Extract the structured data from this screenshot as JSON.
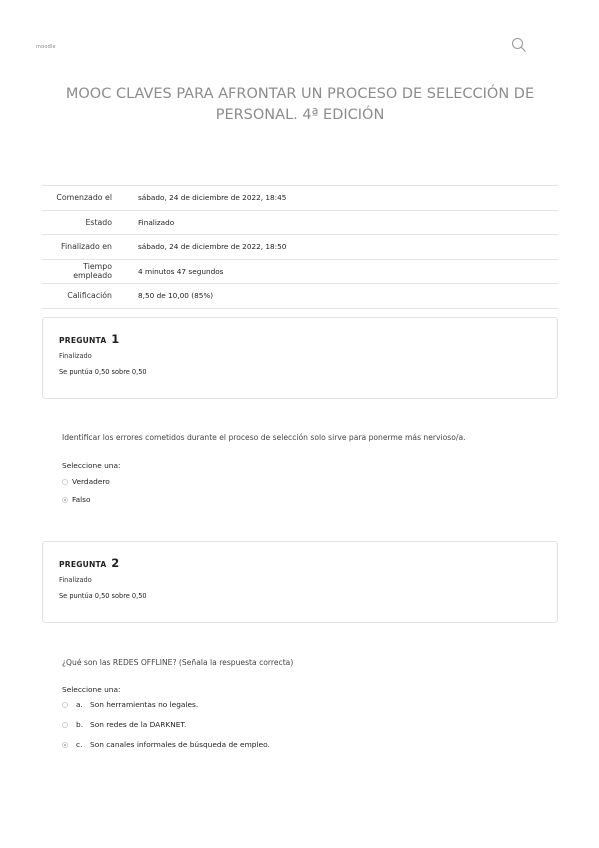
{
  "header": {
    "logo_text": "moodle",
    "search_icon": "search-icon"
  },
  "course": {
    "title": "MOOC CLAVES PARA AFRONTAR UN PROCESO DE SELECCIÓN DE PERSONAL. 4ª EDICIÓN"
  },
  "summary": [
    {
      "key": "Comenzado el",
      "value": "sábado, 24 de diciembre de 2022, 18:45"
    },
    {
      "key": "Estado",
      "value": "Finalizado"
    },
    {
      "key": "Finalizado en",
      "value": "sábado, 24 de diciembre de 2022, 18:50"
    },
    {
      "key": "Tiempo empleado",
      "value": "4 minutos 47 segundos"
    },
    {
      "key": "Calificación",
      "value": "8,50 de 10,00 (85%)"
    }
  ],
  "questions": [
    {
      "label": "PREGUNTA",
      "number": "1",
      "state": "Finalizado",
      "grade": "Se puntúa 0,50 sobre 0,50",
      "text": "Identificar los errores cometidos durante el proceso de selección solo sirve para ponerme más nervioso/a.",
      "select_label": "Seleccione una:",
      "options": [
        {
          "letter": "",
          "text": "Verdadero",
          "checked": false
        },
        {
          "letter": "",
          "text": "Falso",
          "checked": true
        }
      ]
    },
    {
      "label": "PREGUNTA",
      "number": "2",
      "state": "Finalizado",
      "grade": "Se puntúa 0,50 sobre 0,50",
      "text": "¿Qué son las REDES OFFLINE? (Señala la respuesta correcta)",
      "select_label": "Seleccione una:",
      "options": [
        {
          "letter": "a.",
          "text": "Son herramientas no legales.",
          "checked": false
        },
        {
          "letter": "b.",
          "text": "Son redes de la DARKNET.",
          "checked": false
        },
        {
          "letter": "c.",
          "text": "Son canales informales de búsqueda de empleo.",
          "checked": true
        }
      ]
    }
  ]
}
